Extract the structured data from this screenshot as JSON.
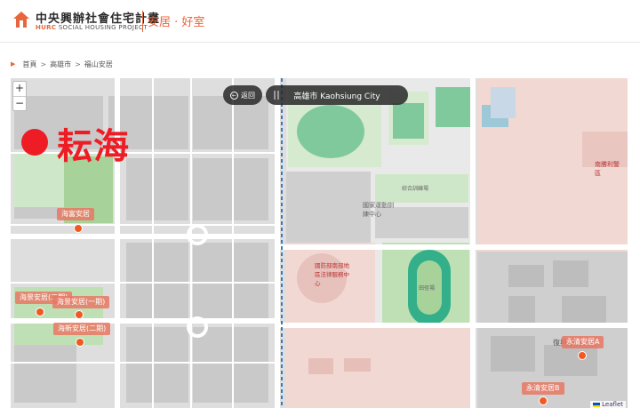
{
  "header": {
    "logo_title": "中央興辦社會住宅計畫",
    "logo_brand": "HURC",
    "logo_subtitle": "SOCIAL HOUSING PROJECT",
    "slogan": "安居 · 好室"
  },
  "breadcrumb": {
    "items": [
      "首頁",
      "高雄市",
      "福山安居"
    ]
  },
  "map": {
    "zoom_in": "+",
    "zoom_out": "−",
    "back_label": "返回",
    "city_label": "高雄市 Kaohsiung City",
    "featured_name": "耘海",
    "attribution": "Leaflet",
    "labels": {
      "sport_center": "國家運動訓練中心",
      "military": "國防部南部地區法律服務中心",
      "police": "南勝利警區",
      "track": "田徑場",
      "gym": "綜合訓練場",
      "xinguo": "復興新村"
    },
    "projects": [
      {
        "name": "海富安居"
      },
      {
        "name": "海景安居(二期)"
      },
      {
        "name": "海景安居(一期)"
      },
      {
        "name": "海新安居(二期)"
      },
      {
        "name": "永清安居A"
      },
      {
        "name": "永清安居B"
      }
    ],
    "colors": {
      "accent": "#e8663d",
      "highlight": "#ee1c24",
      "park": "#cfe7c9",
      "military": "#f2d8d3"
    }
  }
}
